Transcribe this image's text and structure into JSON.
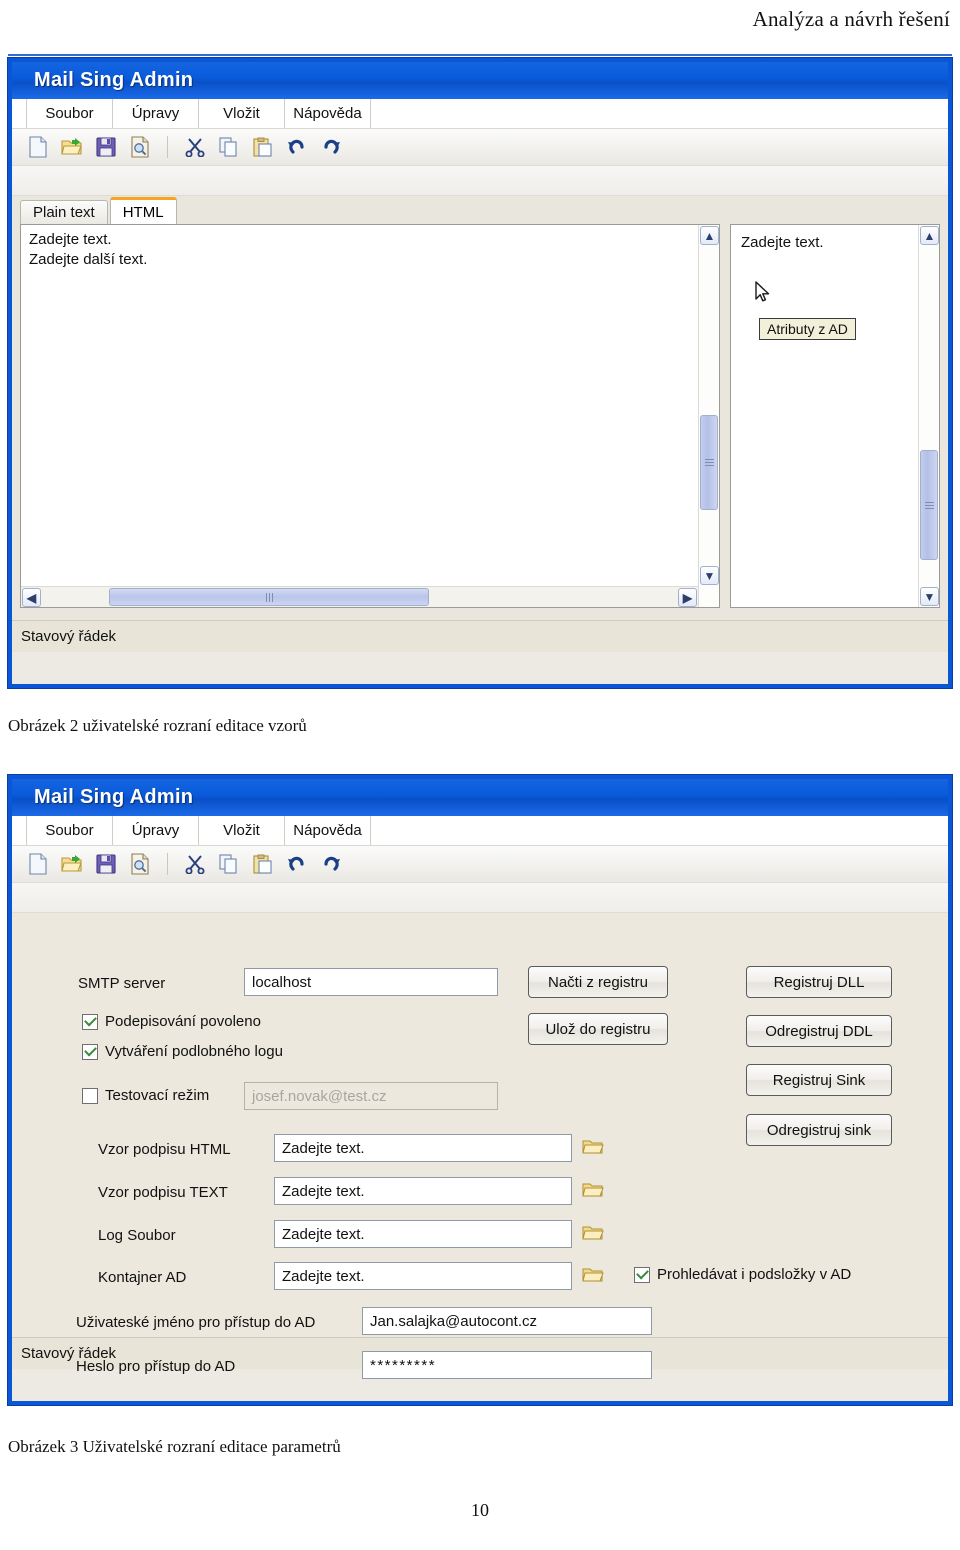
{
  "document": {
    "header_title": "Analýza a návrh řešení",
    "page_number": "10",
    "caption_fig2": "Obrázek 2 uživatelské rozraní editace vzorů",
    "caption_fig3": "Obrázek 3 Uživatelské rozraní editace parametrů"
  },
  "colors": {
    "window_border": "#0a56d6",
    "titlebar": "#0a5bdd",
    "tab_active_accent": "#f3a621",
    "checkbox_check": "#3a8a3a",
    "statusbar_bg": "#e8e4d8",
    "form_bg": "#ece8de",
    "tooltip_bg": "#f3f0da"
  },
  "window1": {
    "title": "Mail Sing Admin",
    "menu": [
      "Soubor",
      "Úpravy",
      "Vložit",
      "Nápověda"
    ],
    "toolbar_icons": [
      "new-document-icon",
      "open-folder-icon",
      "save-floppy-icon",
      "print-preview-icon",
      "cut-scissors-icon",
      "copy-icon",
      "paste-icon",
      "undo-icon",
      "redo-icon"
    ],
    "tabs": [
      {
        "label": "Plain text",
        "active": false
      },
      {
        "label": "HTML",
        "active": true
      }
    ],
    "editor_left_text": "Zadejte text.\nZadejte další text.",
    "editor_right_text": "Zadejte text.",
    "tooltip": "Atributy z AD",
    "statusbar": "Stavový řádek"
  },
  "window2": {
    "title": "Mail Sing Admin",
    "menu": [
      "Soubor",
      "Úpravy",
      "Vložit",
      "Nápověda"
    ],
    "toolbar_icons": [
      "new-document-icon",
      "open-folder-icon",
      "save-floppy-icon",
      "print-preview-icon",
      "cut-scissors-icon",
      "copy-icon",
      "paste-icon",
      "undo-icon",
      "redo-icon"
    ],
    "statusbar": "Stavový řádek",
    "form": {
      "smtp_label": "SMTP server",
      "smtp_value": "localhost",
      "chk_signing": "Podepisování povoleno",
      "chk_signing_checked": true,
      "chk_verbose_log": "Vytváření podlobného logu",
      "chk_verbose_log_checked": true,
      "chk_test_mode": "Testovací režim",
      "chk_test_mode_checked": false,
      "test_mail_value": "josef.novak@test.cz",
      "label_html_template": "Vzor podpisu HTML",
      "value_html_template": "Zadejte text.",
      "label_text_template": "Vzor podpisu TEXT",
      "value_text_template": "Zadejte text.",
      "label_log_file": "Log Soubor",
      "value_log_file": "Zadejte text.",
      "label_ad_container": "Kontajner AD",
      "value_ad_container": "Zadejte text.",
      "chk_subfolders": "Prohledávat i podsložky v AD",
      "chk_subfolders_checked": true,
      "label_ad_user": "Uživateské jméno pro přístup do AD",
      "value_ad_user": "Jan.salajka@autocont.cz",
      "label_ad_password": "Heslo pro přístup do AD",
      "value_ad_password": "*********"
    },
    "buttons": {
      "load_registry": "Načti z registru",
      "save_registry": "Ulož do registru",
      "register_dll": "Registruj DLL",
      "unregister_ddl": "Odregistruj DDL",
      "register_sink": "Registruj Sink",
      "unregister_sink": "Odregistruj sink"
    }
  }
}
